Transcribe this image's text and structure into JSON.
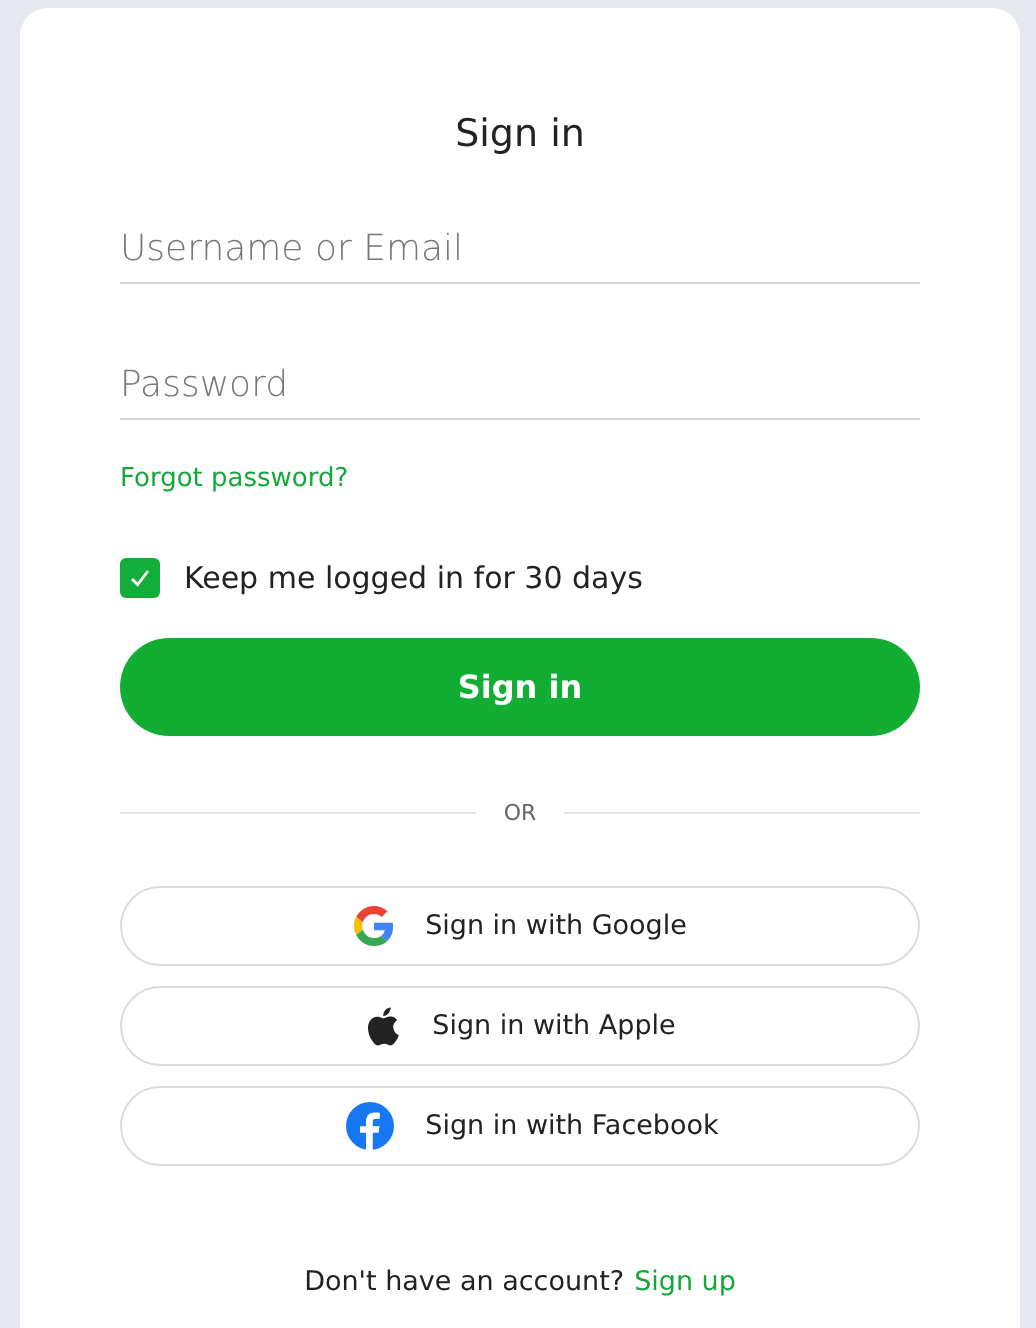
{
  "title": "Sign in",
  "fields": [
    {
      "placeholder": "Username or Email"
    },
    {
      "placeholder": "Password"
    }
  ],
  "forgot_link": "Forgot password?",
  "remember": {
    "label": "Keep me logged in for 30 days",
    "checked": true
  },
  "submit_button": "Sign in",
  "divider": "OR",
  "social_buttons": [
    {
      "kind": "google",
      "label": "Sign in with Google"
    },
    {
      "kind": "apple",
      "label": "Sign in with Apple"
    },
    {
      "kind": "facebook",
      "label": "Sign in with Facebook"
    }
  ],
  "footer": {
    "text": "Don't have an account?",
    "link": "Sign up"
  }
}
